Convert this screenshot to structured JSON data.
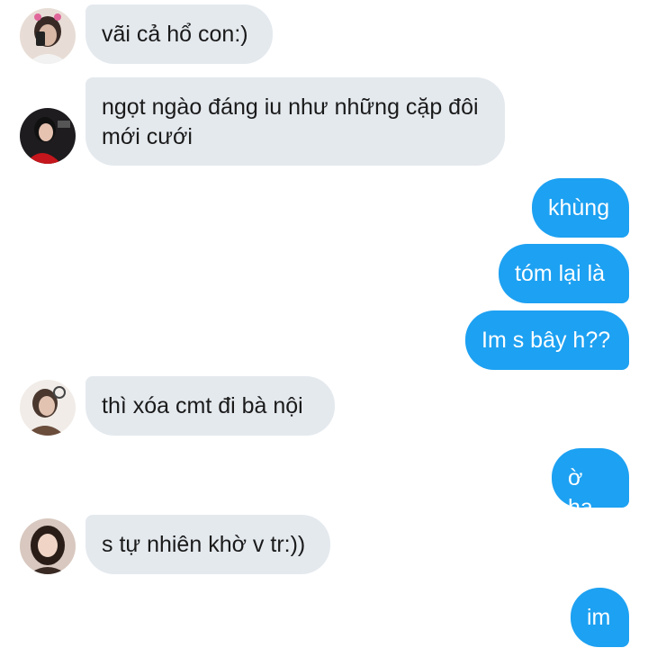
{
  "conversation": {
    "messages": [
      {
        "sender": "other",
        "avatar": "user-avatar-1",
        "text": "vãi cả hổ con:)"
      },
      {
        "sender": "other",
        "avatar": "user-avatar-2",
        "text": "ngọt ngào đáng iu như những cặp đôi mới cưới"
      },
      {
        "sender": "self",
        "text": "khùng"
      },
      {
        "sender": "self",
        "text": "tóm lại là"
      },
      {
        "sender": "self",
        "text": "Im s bây h??"
      },
      {
        "sender": "other",
        "avatar": "user-avatar-3",
        "text": "thì xóa cmt đi bà nội"
      },
      {
        "sender": "self",
        "text": "ờ ha"
      },
      {
        "sender": "other",
        "avatar": "user-avatar-4",
        "text": "s tự nhiên khờ v tr:))"
      },
      {
        "sender": "self",
        "text": "im"
      }
    ]
  },
  "colors": {
    "incoming_bubble": "#e4e9ee",
    "outgoing_bubble": "#1da1f2",
    "outgoing_text": "#ffffff",
    "incoming_text": "#1a1a1a"
  }
}
